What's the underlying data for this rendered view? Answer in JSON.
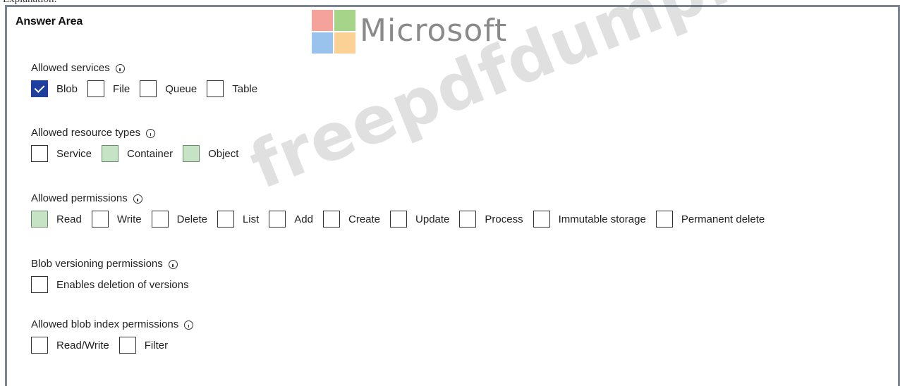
{
  "header": {
    "cut_text": "Explanation:",
    "area_title": "Answer Area",
    "brand_word": "Microsoft"
  },
  "watermark": "freepdfdump.top",
  "colors": {
    "checked": "#1f3f9e",
    "highlight": "#c6e3c6",
    "frame": "#7b8591"
  },
  "groups": [
    {
      "label": "Allowed services",
      "options": [
        {
          "label": "Blob",
          "state": "checked"
        },
        {
          "label": "File",
          "state": "unchecked"
        },
        {
          "label": "Queue",
          "state": "unchecked"
        },
        {
          "label": "Table",
          "state": "unchecked"
        }
      ]
    },
    {
      "label": "Allowed resource types",
      "options": [
        {
          "label": "Service",
          "state": "unchecked"
        },
        {
          "label": "Container",
          "state": "highlighted"
        },
        {
          "label": "Object",
          "state": "highlighted"
        }
      ]
    },
    {
      "label": "Allowed permissions",
      "options": [
        {
          "label": "Read",
          "state": "highlighted"
        },
        {
          "label": "Write",
          "state": "unchecked"
        },
        {
          "label": "Delete",
          "state": "unchecked"
        },
        {
          "label": "List",
          "state": "unchecked"
        },
        {
          "label": "Add",
          "state": "unchecked"
        },
        {
          "label": "Create",
          "state": "unchecked"
        },
        {
          "label": "Update",
          "state": "unchecked"
        },
        {
          "label": "Process",
          "state": "unchecked"
        },
        {
          "label": "Immutable storage",
          "state": "unchecked"
        },
        {
          "label": "Permanent delete",
          "state": "unchecked"
        }
      ]
    },
    {
      "label": "Blob versioning permissions",
      "options": [
        {
          "label": "Enables deletion of versions",
          "state": "unchecked"
        }
      ]
    },
    {
      "label": "Allowed blob index permissions",
      "options": [
        {
          "label": "Read/Write",
          "state": "unchecked"
        },
        {
          "label": "Filter",
          "state": "unchecked"
        }
      ]
    }
  ]
}
